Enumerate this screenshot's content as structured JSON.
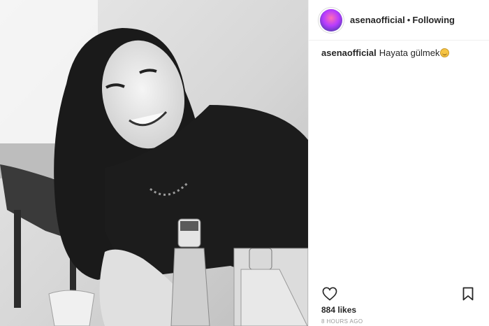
{
  "post": {
    "username": "asenaofficial",
    "separator": "•",
    "follow_status": "Following",
    "caption": {
      "username": "asenaofficial",
      "text": "Hayata gülmek"
    },
    "likes": "884 likes",
    "timestamp": "8 HOURS AGO",
    "icons": {
      "like": "heart-outline-icon",
      "save": "bookmark-outline-icon",
      "emoji": "smiling-face-emoji"
    }
  }
}
